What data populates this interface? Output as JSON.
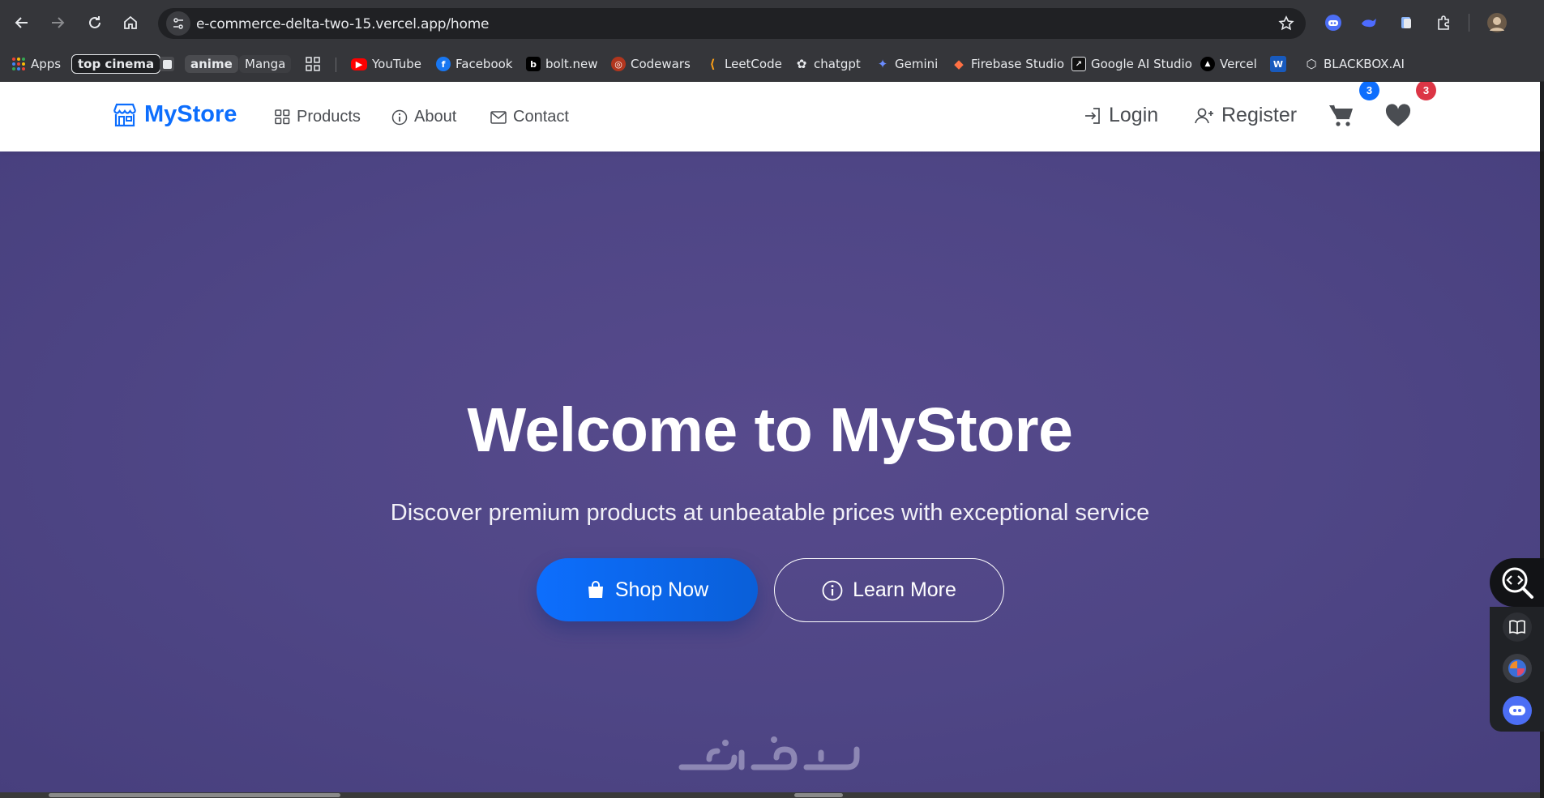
{
  "browser": {
    "url": "e-commerce-delta-two-15.vercel.app/home",
    "bookmarks": [
      {
        "label": "Apps",
        "icon": "apps-grid-icon"
      },
      {
        "label": "top cinema",
        "icon": ""
      },
      {
        "label": "",
        "icon": "folder-square-icon"
      },
      {
        "label": "anime",
        "icon": ""
      },
      {
        "label": "Manga",
        "icon": ""
      },
      {
        "label": "",
        "icon": "grid-icon"
      },
      {
        "label": "YouTube",
        "icon": "youtube-icon"
      },
      {
        "label": "Facebook",
        "icon": "facebook-icon"
      },
      {
        "label": "bolt.new",
        "icon": "bolt-icon"
      },
      {
        "label": "Codewars",
        "icon": "codewars-icon"
      },
      {
        "label": "LeetCode",
        "icon": "leetcode-icon"
      },
      {
        "label": "chatgpt",
        "icon": "openai-icon"
      },
      {
        "label": "Gemini",
        "icon": "gemini-icon"
      },
      {
        "label": "Firebase Studio",
        "icon": "firebase-icon"
      },
      {
        "label": "Google AI Studio",
        "icon": "ai-studio-icon"
      },
      {
        "label": "Vercel",
        "icon": "vercel-icon"
      },
      {
        "label": "",
        "icon": "word-icon"
      },
      {
        "label": "BLACKBOX.AI",
        "icon": "blackbox-icon"
      }
    ]
  },
  "navbar": {
    "brand": "MyStore",
    "links": {
      "products": "Products",
      "about": "About",
      "contact": "Contact"
    },
    "login": "Login",
    "register": "Register",
    "cart_count": "3",
    "wishlist_count": "3"
  },
  "hero": {
    "title": "Welcome to MyStore",
    "subtitle": "Discover premium products at unbeatable prices with exceptional service",
    "shop_now": "Shop Now",
    "learn_more": "Learn More"
  },
  "colors": {
    "primary": "#0d6efd",
    "hero_bg": "#4f4686",
    "badge_blue": "#0d6efd",
    "badge_red": "#dc3545",
    "chrome": "#35363a"
  }
}
